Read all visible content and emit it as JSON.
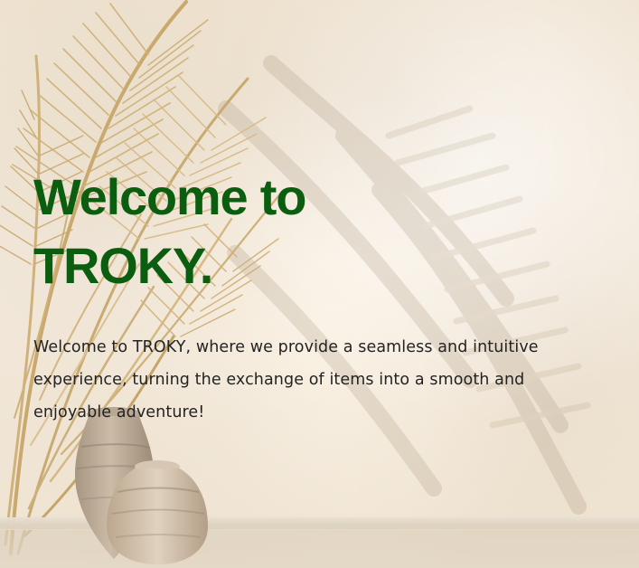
{
  "hero": {
    "title_line_1": "Welcome to",
    "title_line_2": "TROKY.",
    "description": "Welcome to TROKY, where we provide a seamless and intuitive experience, turning the exchange of items into a smooth and enjoyable adventure!"
  },
  "visuals": {
    "brand_green": "#0b5d10",
    "text_dark": "#232323",
    "wall_beige": "#efe3d1",
    "plant_gold": "#cfb27a",
    "vase_taupe": "#bfae98"
  },
  "icons": {
    "decorative_plant": "palm-leaves",
    "decorative_vases": "clay-vases"
  }
}
